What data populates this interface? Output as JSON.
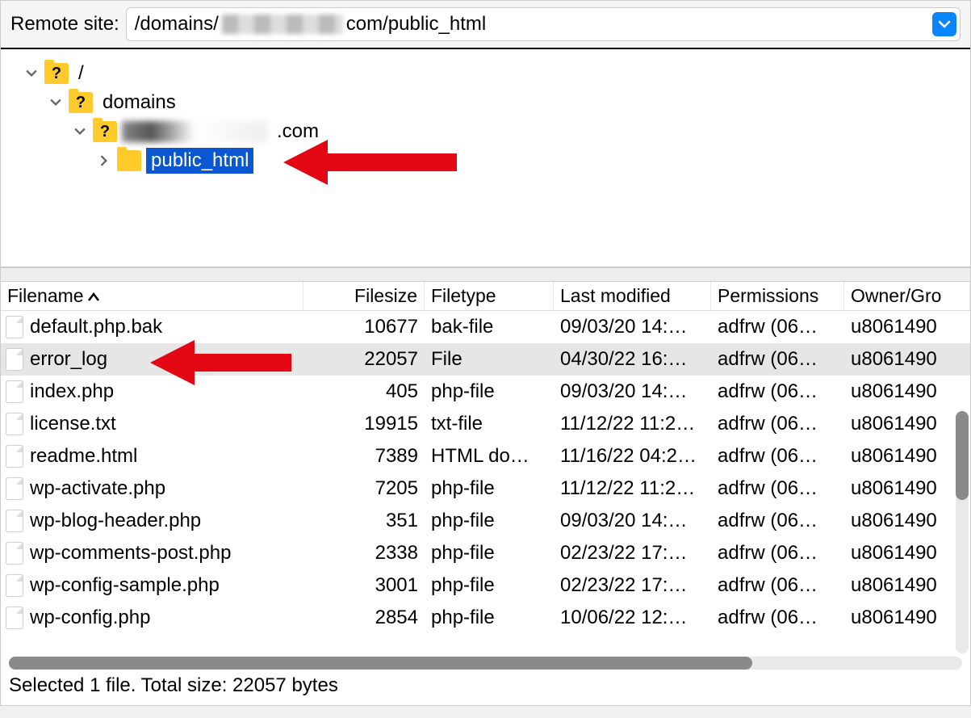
{
  "addressBar": {
    "label": "Remote site:",
    "path_prefix": "/domains/",
    "path_suffix": "com/public_html"
  },
  "tree": {
    "root": "/",
    "node1": "domains",
    "node2_suffix": ".com",
    "node3": "public_html"
  },
  "columns": {
    "name": "Filename",
    "size": "Filesize",
    "type": "Filetype",
    "modified": "Last modified",
    "perms": "Permissions",
    "owner": "Owner/Gro"
  },
  "rows": [
    {
      "name": "default.php.bak",
      "size": "10677",
      "type": "bak-file",
      "mod": "09/03/20 14:…",
      "perm": "adfrw (06…",
      "own": "u8061490"
    },
    {
      "name": "error_log",
      "size": "22057",
      "type": "File",
      "mod": "04/30/22 16:…",
      "perm": "adfrw (06…",
      "own": "u8061490"
    },
    {
      "name": "index.php",
      "size": "405",
      "type": "php-file",
      "mod": "09/03/20 14:…",
      "perm": "adfrw (06…",
      "own": "u8061490"
    },
    {
      "name": "license.txt",
      "size": "19915",
      "type": "txt-file",
      "mod": "11/12/22 11:2…",
      "perm": "adfrw (06…",
      "own": "u8061490"
    },
    {
      "name": "readme.html",
      "size": "7389",
      "type": "HTML do…",
      "mod": "11/16/22 04:2…",
      "perm": "adfrw (06…",
      "own": "u8061490"
    },
    {
      "name": "wp-activate.php",
      "size": "7205",
      "type": "php-file",
      "mod": "11/12/22 11:2…",
      "perm": "adfrw (06…",
      "own": "u8061490"
    },
    {
      "name": "wp-blog-header.php",
      "size": "351",
      "type": "php-file",
      "mod": "09/03/20 14:…",
      "perm": "adfrw (06…",
      "own": "u8061490"
    },
    {
      "name": "wp-comments-post.php",
      "size": "2338",
      "type": "php-file",
      "mod": "02/23/22 17:…",
      "perm": "adfrw (06…",
      "own": "u8061490"
    },
    {
      "name": "wp-config-sample.php",
      "size": "3001",
      "type": "php-file",
      "mod": "02/23/22 17:…",
      "perm": "adfrw (06…",
      "own": "u8061490"
    },
    {
      "name": "wp-config.php",
      "size": "2854",
      "type": "php-file",
      "mod": "10/06/22 12:…",
      "perm": "adfrw (06…",
      "own": "u8061490"
    }
  ],
  "statusBar": "Selected 1 file. Total size: 22057 bytes"
}
